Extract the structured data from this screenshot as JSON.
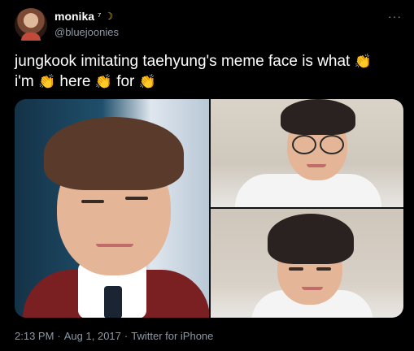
{
  "author": {
    "display_name": "monika",
    "name_suffix": "⁷",
    "handle": "@bluejoonies"
  },
  "tweet": {
    "text_parts": [
      "jungkook imitating taehyung's meme face is what",
      "i'm",
      "here",
      "for"
    ],
    "emoji": "👏"
  },
  "media": {
    "images": [
      "photo-left",
      "photo-top-right",
      "photo-bottom-right"
    ]
  },
  "meta": {
    "time": "2:13 PM",
    "separator": "·",
    "date": "Aug 1, 2017",
    "source": "Twitter for iPhone"
  },
  "icons": {
    "moon": "crescent-moon-icon",
    "more": "more-horizontal-icon",
    "clap": "clapping-hands-icon"
  },
  "colors": {
    "background": "#000000",
    "text": "#ffffff",
    "muted": "#8b98a5"
  }
}
